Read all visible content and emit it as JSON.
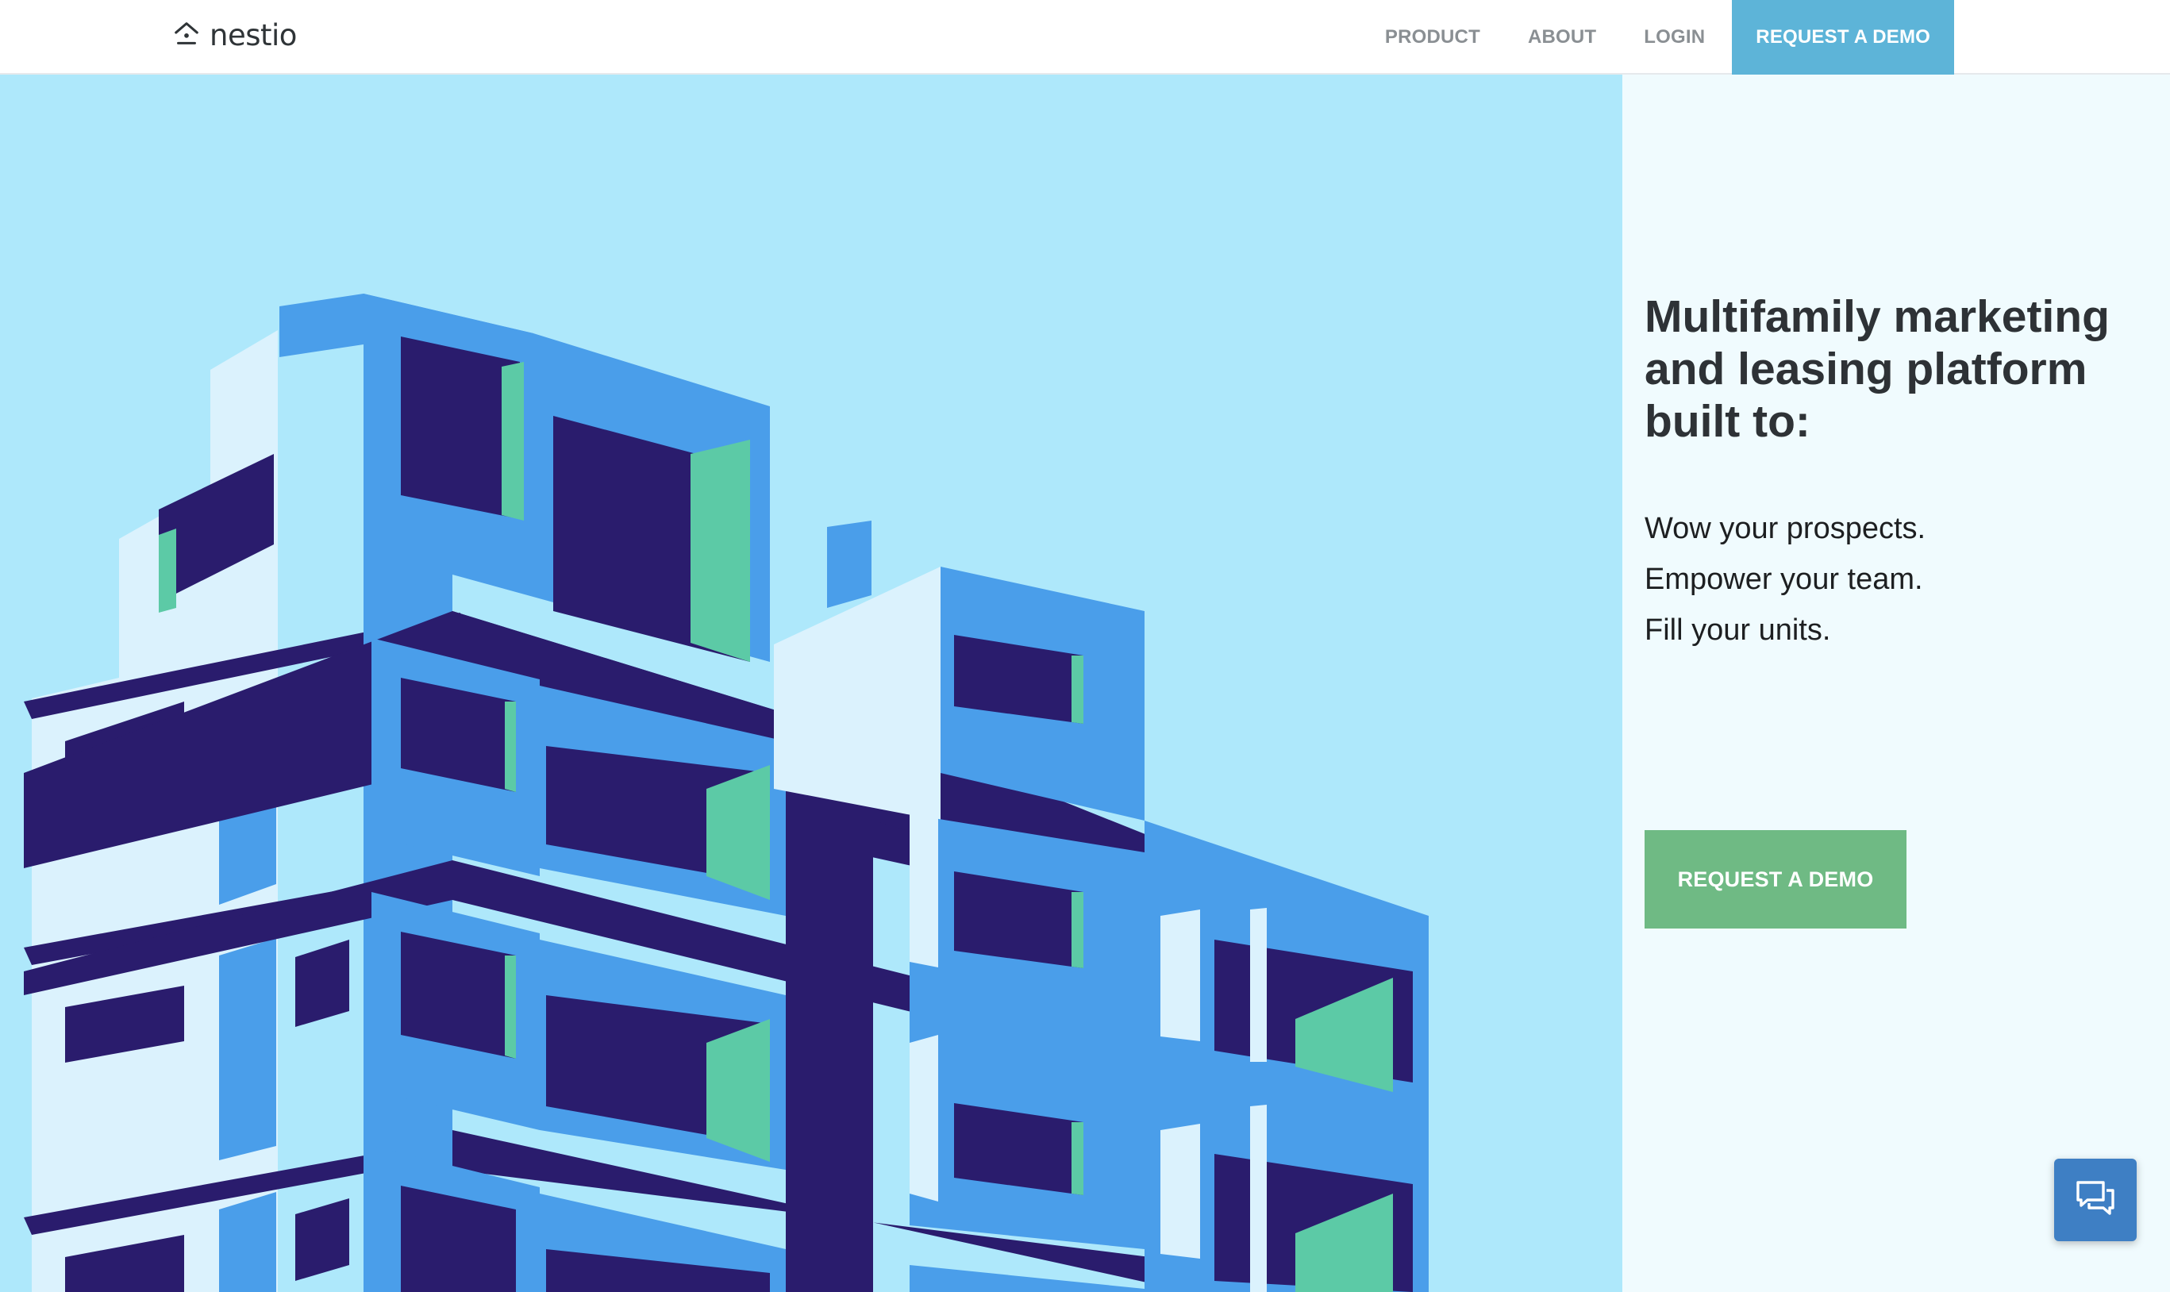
{
  "brand": {
    "name": "nestio",
    "logo_icon": "house-icon"
  },
  "nav": {
    "items": [
      {
        "label": "PRODUCT"
      },
      {
        "label": "ABOUT"
      },
      {
        "label": "LOGIN"
      }
    ],
    "demo_label": "REQUEST A DEMO"
  },
  "hero": {
    "headline": "Multifamily marketing and leasing platform built to:",
    "taglines": [
      "Wow your prospects.",
      "Empower your team.",
      "Fill your units."
    ],
    "cta_label": "REQUEST A DEMO",
    "illustration": "apartment-building-illustration"
  },
  "chat": {
    "icon": "chat-bubbles-icon"
  },
  "colors": {
    "nav_demo_bg": "#5db4d8",
    "cta_bg": "#6fba84",
    "hero_sky": "#aee8fb",
    "panel_bg": "#f0fbfe",
    "chat_bg": "#3e7fc4"
  }
}
